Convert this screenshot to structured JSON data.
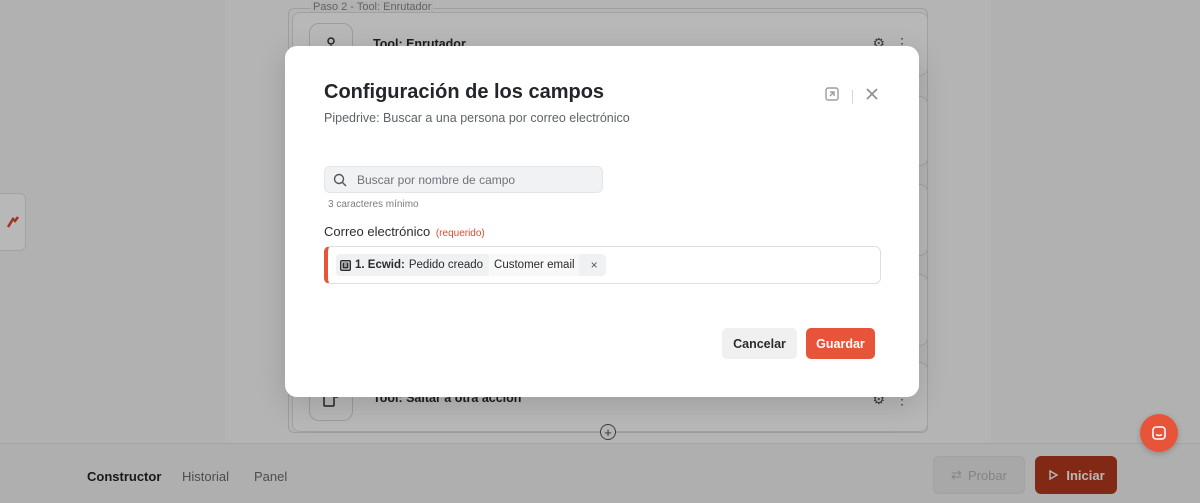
{
  "workflow": {
    "group_label": "Paso 2 - Tool: Enrutador",
    "steps": [
      {
        "title": "Tool: Enrutador",
        "icon": "router-icon"
      },
      {
        "title": "Tool: Saltar a otra acción",
        "icon": "jump-icon"
      }
    ],
    "add_step_label": "+"
  },
  "bottom_nav": {
    "tabs": [
      {
        "label": "Constructor",
        "active": true
      },
      {
        "label": "Historial",
        "active": false
      },
      {
        "label": "Panel",
        "active": false
      }
    ],
    "probar_label": "Probar",
    "iniciar_label": "Iniciar"
  },
  "modal": {
    "title": "Configuración de los campos",
    "subtitle": "Pipedrive: Buscar a una persona por correo electrónico",
    "search": {
      "placeholder": "Buscar por nombre de campo",
      "value": "",
      "hint": "3 caracteres mínimo"
    },
    "field": {
      "label": "Correo electrónico",
      "required_label": "(requerido)",
      "chip": {
        "step_ref": "1. Ecwid:",
        "event": "Pedido creado",
        "value": "Customer email",
        "remove": "×"
      }
    },
    "cancel_label": "Cancelar",
    "save_label": "Guardar"
  },
  "colors": {
    "accent": "#e8543a",
    "iniciar_bg": "#b5391f",
    "required": "#e0482c"
  }
}
